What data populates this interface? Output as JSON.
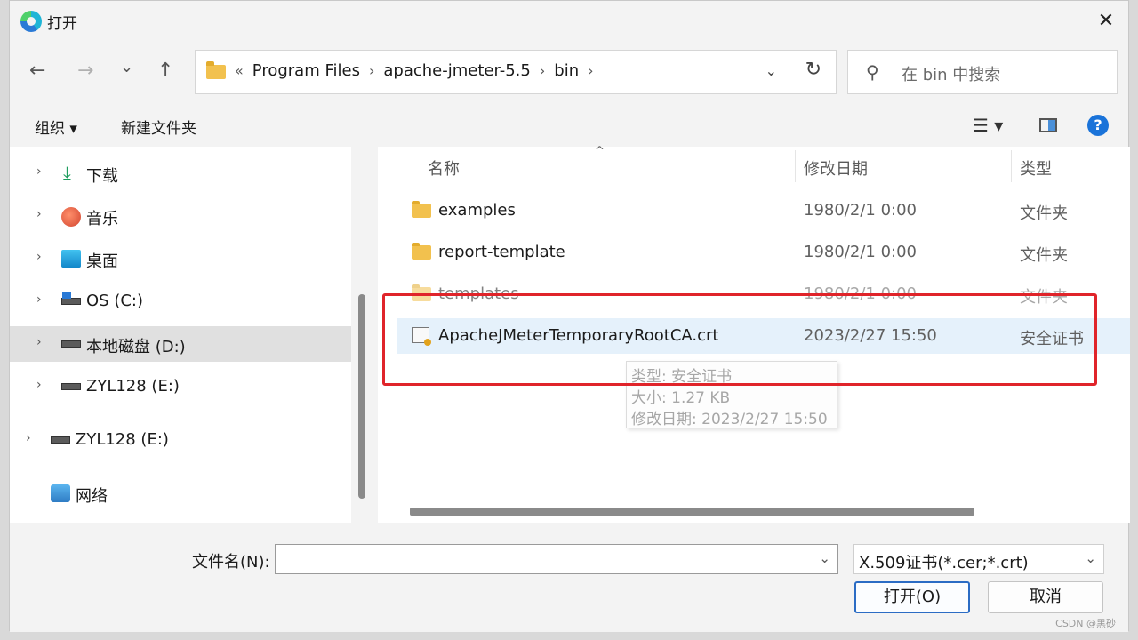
{
  "window": {
    "title": "打开",
    "close": "✕"
  },
  "nav": {
    "back": "←",
    "forward": "→",
    "recent": "⌄",
    "up": "↑",
    "crumbs": [
      "«",
      "Program Files",
      "apache-jmeter-5.5",
      "bin"
    ],
    "addr_dropdown": "⌄",
    "refresh": "↻",
    "search_placeholder": "在 bin 中搜索"
  },
  "toolbar": {
    "organize": "组织 ▾",
    "new_folder": "新建文件夹",
    "view": "☰  ▾",
    "help": "?"
  },
  "sidebar": {
    "items": [
      {
        "label": "下载",
        "chevron": "›"
      },
      {
        "label": "音乐",
        "chevron": "›"
      },
      {
        "label": "桌面",
        "chevron": "›"
      },
      {
        "label": "OS (C:)",
        "chevron": "›"
      },
      {
        "label": "本地磁盘 (D:)",
        "chevron": "›"
      },
      {
        "label": "ZYL128 (E:)",
        "chevron": "›"
      },
      {
        "label": "ZYL128 (E:)",
        "chevron": "›"
      },
      {
        "label": "网络"
      }
    ]
  },
  "filelist": {
    "columns": {
      "name": "名称",
      "date": "修改日期",
      "type": "类型",
      "sort": "^"
    },
    "rows": [
      {
        "name": "examples",
        "date": "1980/2/1 0:00",
        "type": "文件夹"
      },
      {
        "name": "report-template",
        "date": "1980/2/1 0:00",
        "type": "文件夹"
      },
      {
        "name": "templates",
        "date": "1980/2/1 0:00",
        "type": "文件夹"
      },
      {
        "name": "ApacheJMeterTemporaryRootCA.crt",
        "date": "2023/2/27 15:50",
        "type": "安全证书"
      }
    ]
  },
  "tooltip": {
    "type": "类型: 安全证书",
    "size": "大小: 1.27 KB",
    "date": "修改日期: 2023/2/27 15:50"
  },
  "bottom": {
    "filename_label": "文件名(N):",
    "filename_value": "",
    "filetype": "X.509证书(*.cer;*.crt)",
    "dropdown": "⌄",
    "open": "打开(O)",
    "cancel": "取消"
  },
  "watermark": "CSDN @黑砂",
  "colors": {
    "highlight": "#e0242a",
    "selection": "#e5f1fb",
    "accent": "#2b6cc4"
  }
}
